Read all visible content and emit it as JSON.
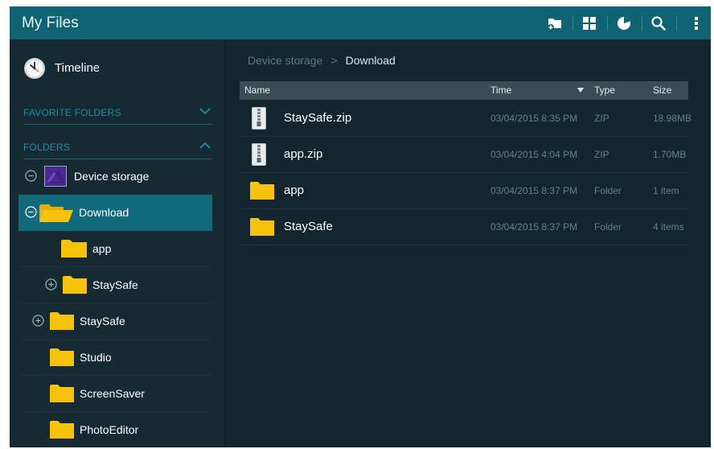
{
  "header": {
    "title": "My Files",
    "icons": [
      "create-folder-icon",
      "grid-view-icon",
      "storage-usage-icon",
      "search-icon",
      "more-options-icon"
    ]
  },
  "sidebar": {
    "timeline_label": "Timeline",
    "favorites_label": "FAVORITE FOLDERS",
    "folders_label": "FOLDERS",
    "tree": [
      {
        "label": "Device storage",
        "expander": "collapse",
        "icon": "device"
      },
      {
        "label": "Download",
        "expander": "collapse",
        "icon": "folder-open",
        "selected": true
      },
      {
        "label": "app",
        "expander": "none",
        "icon": "folder"
      },
      {
        "label": "StaySafe",
        "expander": "expand",
        "icon": "folder"
      },
      {
        "label": "StaySafe",
        "expander": "expand",
        "icon": "folder"
      },
      {
        "label": "Studio",
        "expander": "none",
        "icon": "folder"
      },
      {
        "label": "ScreenSaver",
        "expander": "none",
        "icon": "folder"
      },
      {
        "label": "PhotoEditor",
        "expander": "none",
        "icon": "folder"
      }
    ]
  },
  "breadcrumb": {
    "root": "Device storage",
    "separator": ">",
    "current": "Download"
  },
  "table": {
    "columns": {
      "name": "Name",
      "time": "Time",
      "type": "Type",
      "size": "Size"
    },
    "rows": [
      {
        "name": "StaySafe.zip",
        "time": "03/04/2015 8:35 PM",
        "type": "ZIP",
        "size": "18.98MB",
        "icon": "zip"
      },
      {
        "name": "app.zip",
        "time": "03/04/2015 4:04 PM",
        "type": "ZIP",
        "size": "1.70MB",
        "icon": "zip"
      },
      {
        "name": "app",
        "time": "03/04/2015 8:37 PM",
        "type": "Folder",
        "size": "1 item",
        "icon": "folder"
      },
      {
        "name": "StaySafe",
        "time": "03/04/2015 8:37 PM",
        "type": "Folder",
        "size": "4 items",
        "icon": "folder"
      }
    ]
  },
  "colors": {
    "header": "#0f6373",
    "background": "#14262e",
    "selected_row": "#106a7c",
    "folder": "#f7c20a",
    "section_label": "#1f8fa6",
    "table_header": "#3a4d55"
  }
}
